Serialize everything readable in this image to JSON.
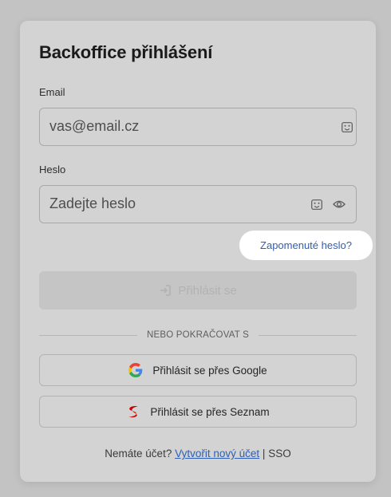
{
  "login": {
    "title": "Backoffice přihlášení",
    "email_label": "Email",
    "email_placeholder": "vas@email.cz",
    "password_label": "Heslo",
    "password_placeholder": "Zadejte heslo",
    "forgot_password": "Zapomenuté heslo?",
    "submit_label": "Přihlásit se",
    "divider_text": "NEBO POKRAČOVAT S",
    "google_label": "Přihlásit se přes Google",
    "seznam_label": "Přihlásit se přes Seznam",
    "footer_prompt": "Nemáte účet?",
    "create_account": "Vytvořit nový účet",
    "separator": "|",
    "sso": "SSO"
  },
  "icons": {
    "email_field": "keyboard-icon",
    "password_field": [
      "keyboard-icon",
      "eye-icon"
    ],
    "submit": "login-arrow-icon",
    "google": "google-icon",
    "seznam": "seznam-icon"
  },
  "colors": {
    "link": "#2f5fb3",
    "google_blue": "#4285F4",
    "google_red": "#EA4335",
    "google_yellow": "#FBBC05",
    "google_green": "#34A853",
    "seznam_red": "#cc0000"
  }
}
